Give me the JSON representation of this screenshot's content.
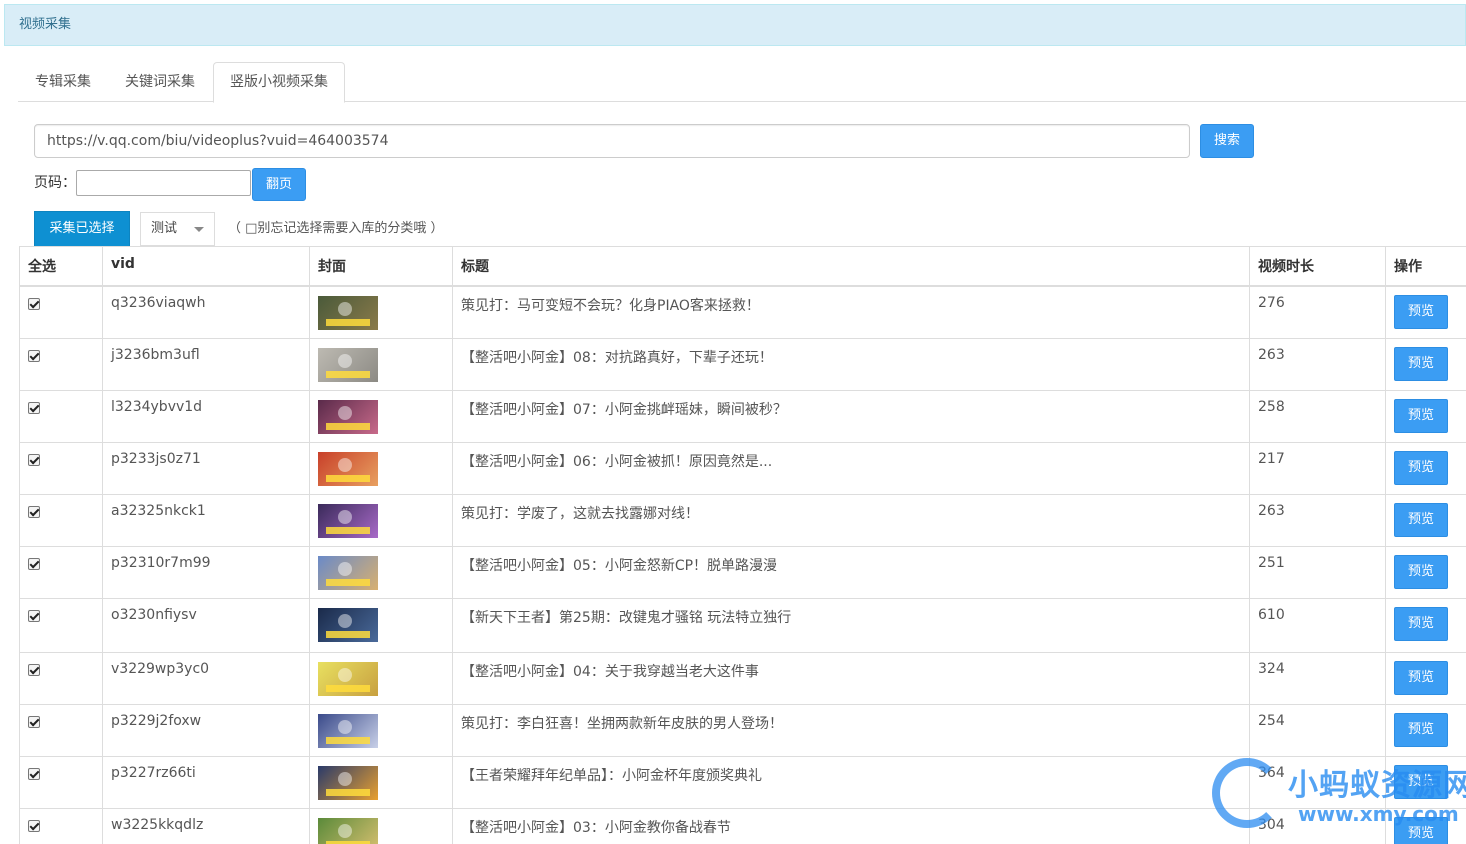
{
  "panel": {
    "title": "视频采集"
  },
  "tabs": [
    {
      "label": "专辑采集",
      "active": false
    },
    {
      "label": "关键词采集",
      "active": false
    },
    {
      "label": "竖版小视频采集",
      "active": true
    }
  ],
  "search": {
    "url_value": "https://v.qq.com/biu/videoplus?vuid=464003574",
    "button_label": "搜索"
  },
  "pager": {
    "label": "页码：",
    "value": "",
    "button_label": "翻页"
  },
  "toolbar": {
    "collect_label": "采集已选择",
    "category_selected": "测试",
    "hint": "（ □别忘记选择需要入库的分类哦 ）"
  },
  "table": {
    "headers": {
      "select_all": "全选",
      "vid": "vid",
      "cover": "封面",
      "title": "标题",
      "duration": "视频时长",
      "action": "操作"
    },
    "preview_label": "预览",
    "rows": [
      {
        "checked": true,
        "vid": "q3236viaqwh",
        "title": "策见打：马可变短不会玩？化身PIAO客来拯救！",
        "duration": "276",
        "thumb_colors": [
          "#4a5a3a",
          "#8a7a4a"
        ]
      },
      {
        "checked": true,
        "vid": "j3236bm3ufl",
        "title": "【整活吧小阿金】08：对抗路真好，下辈子还玩！",
        "duration": "263",
        "thumb_colors": [
          "#bdbab2",
          "#8c8a84"
        ]
      },
      {
        "checked": true,
        "vid": "l3234ybvv1d",
        "title": "【整活吧小阿金】07：小阿金挑衅瑶妹，瞬间被秒？",
        "duration": "258",
        "thumb_colors": [
          "#5a2a4a",
          "#c86a8a"
        ]
      },
      {
        "checked": true,
        "vid": "p3233js0z71",
        "title": "【整活吧小阿金】06：小阿金被抓！原因竟然是...",
        "duration": "217",
        "thumb_colors": [
          "#c8402a",
          "#e8a060"
        ]
      },
      {
        "checked": true,
        "vid": "a32325nkck1",
        "title": "策见打：学废了，这就去找露娜对线！",
        "duration": "263",
        "thumb_colors": [
          "#3a2a5a",
          "#a86ac8"
        ]
      },
      {
        "checked": true,
        "vid": "p32310r7m99",
        "title": "【整活吧小阿金】05：小阿金怒新CP！脱单路漫漫",
        "duration": "251",
        "thumb_colors": [
          "#6a8ac8",
          "#d8b070"
        ]
      },
      {
        "checked": true,
        "vid": "o3230nfiysv",
        "title": "【新天下王者】第25期：改键鬼才骚铭 玩法特立独行",
        "duration": "610",
        "thumb_colors": [
          "#1a2a4a",
          "#4a6a9a"
        ]
      },
      {
        "checked": true,
        "vid": "v3229wp3yc0",
        "title": "【整活吧小阿金】04：关于我穿越当老大这件事",
        "duration": "324",
        "thumb_colors": [
          "#e8e060",
          "#c8a040"
        ]
      },
      {
        "checked": true,
        "vid": "p3229j2foxw",
        "title": "策见打：李白狂喜！坐拥两款新年皮肤的男人登场！",
        "duration": "254",
        "thumb_colors": [
          "#3a4a8a",
          "#c8d0e8"
        ]
      },
      {
        "checked": true,
        "vid": "p3227rz66ti",
        "title": "【王者荣耀拜年纪单品】：小阿金杯年度颁奖典礼",
        "duration": "364",
        "thumb_colors": [
          "#2a3a6a",
          "#e8a030"
        ]
      },
      {
        "checked": true,
        "vid": "w3225kkqdlz",
        "title": "【整活吧小阿金】03：小阿金教你备战春节",
        "duration": "304",
        "thumb_colors": [
          "#5a8a3a",
          "#d8c070"
        ]
      }
    ]
  },
  "watermark": {
    "text": "小蚂蚁资源网",
    "url": "www.xmy.com",
    "color": "#2d8cf0"
  }
}
